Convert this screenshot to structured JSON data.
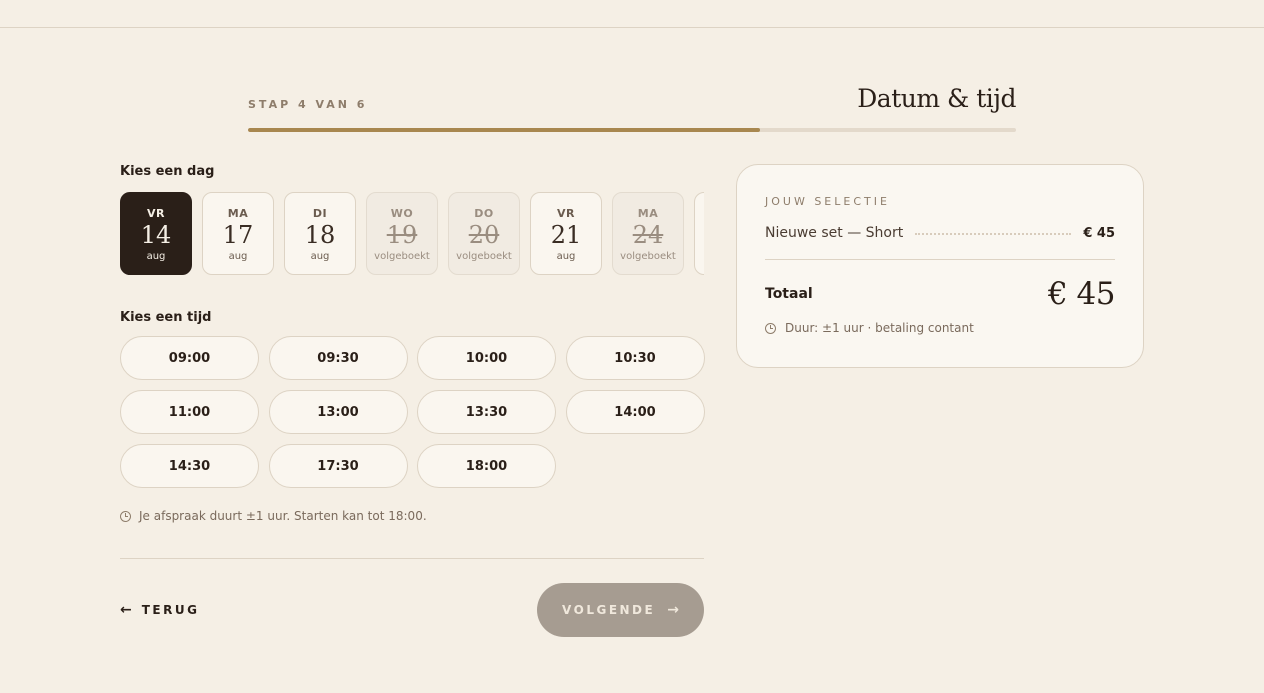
{
  "step": {
    "label": "STAP 4 VAN 6",
    "title": "Datum & tijd",
    "progress": 0.667
  },
  "day_section": {
    "label": "Kies een dag",
    "days": [
      {
        "dow": "VR",
        "num": "14",
        "sub": "aug",
        "state": "selected"
      },
      {
        "dow": "MA",
        "num": "17",
        "sub": "aug",
        "state": "available"
      },
      {
        "dow": "DI",
        "num": "18",
        "sub": "aug",
        "state": "available"
      },
      {
        "dow": "WO",
        "num": "19",
        "sub": "volgeboekt",
        "state": "booked"
      },
      {
        "dow": "DO",
        "num": "20",
        "sub": "volgeboekt",
        "state": "booked"
      },
      {
        "dow": "VR",
        "num": "21",
        "sub": "aug",
        "state": "available"
      },
      {
        "dow": "MA",
        "num": "24",
        "sub": "volgeboekt",
        "state": "booked"
      },
      {
        "dow": "",
        "num": "",
        "sub": "",
        "state": "available"
      }
    ]
  },
  "time_section": {
    "label": "Kies een tijd",
    "times": [
      "09:00",
      "09:30",
      "10:00",
      "10:30",
      "11:00",
      "13:00",
      "13:30",
      "14:00",
      "14:30",
      "17:30",
      "18:00"
    ]
  },
  "note": "Je afspraak duurt ±1 uur. Starten kan tot 18:00.",
  "nav": {
    "back_label": "TERUG",
    "next_label": "VOLGENDE"
  },
  "summary": {
    "title": "JOUW SELECTIE",
    "item_name": "Nieuwe set — Short",
    "item_price": "€ 45",
    "total_label": "Totaal",
    "total_price": "€ 45",
    "duration": "Duur: ±1 uur · betaling contant"
  },
  "icons": {
    "back": "arrow-left-icon",
    "next": "arrow-right-icon",
    "clock": "clock-icon"
  }
}
